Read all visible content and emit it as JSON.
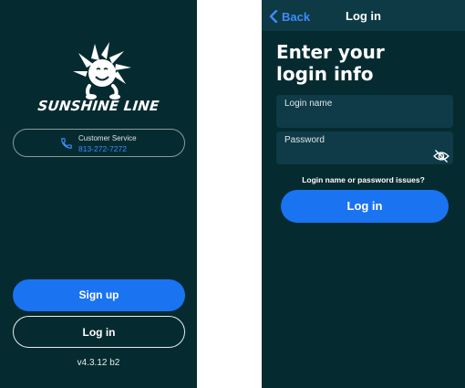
{
  "left_screen": {
    "logo_text": "SUNSHINE LINE",
    "customer_service": {
      "label": "Customer Service",
      "phone": "813-272-7272"
    },
    "signup_label": "Sign up",
    "login_label": "Log in",
    "version": "v4.3.12 b2"
  },
  "right_screen": {
    "back_label": "Back",
    "title": "Log in",
    "heading_line1": "Enter your",
    "heading_line2": "login info",
    "login_name_placeholder": "Login name",
    "password_placeholder": "Password",
    "issues_link": "Login name or password issues?",
    "login_button": "Log in"
  },
  "icons": {
    "logo": "sunshine-sun-logo",
    "phone": "phone-icon",
    "back": "chevron-left-icon",
    "password_visibility": "eye-slash-icon"
  },
  "colors": {
    "background": "#052b30",
    "accent": "#1a73f0",
    "link": "#3d8bfd",
    "field": "#0e3b47"
  }
}
